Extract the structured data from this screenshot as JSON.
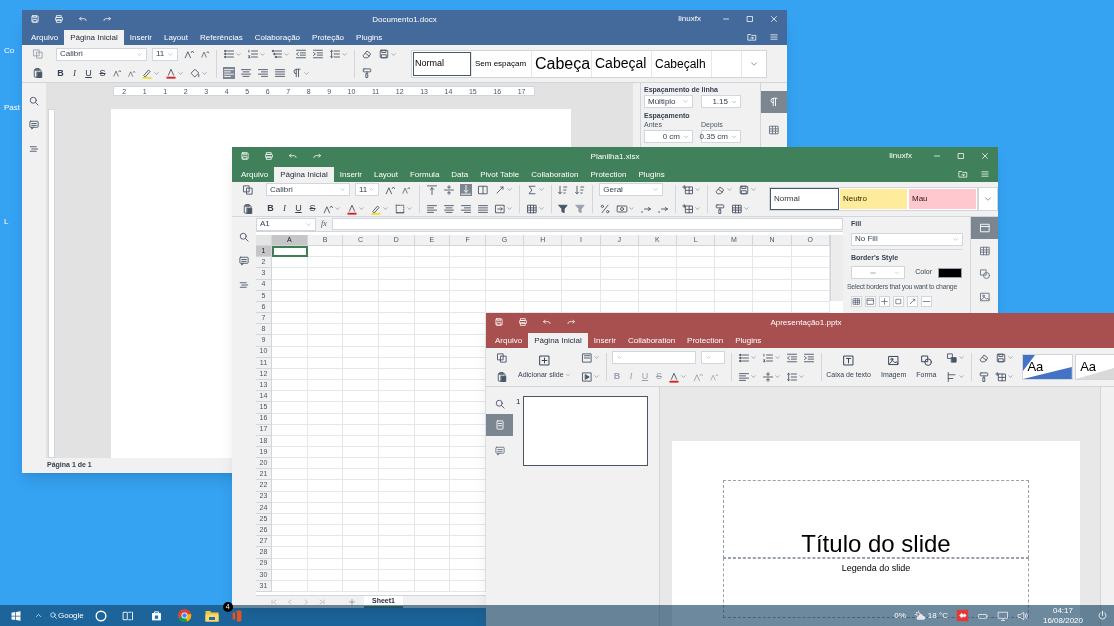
{
  "desktop_icons": [
    {
      "label": "Co"
    },
    {
      "label": "Past"
    },
    {
      "label": "L"
    }
  ],
  "document_window": {
    "title": "Documento1.docx",
    "user": "linuxfx",
    "tabs": [
      {
        "label": "Arquivo",
        "selected": false
      },
      {
        "label": "Página Inicial",
        "selected": true
      },
      {
        "label": "Inserir",
        "selected": false
      },
      {
        "label": "Layout",
        "selected": false
      },
      {
        "label": "Referências",
        "selected": false
      },
      {
        "label": "Colaboração",
        "selected": false
      },
      {
        "label": "Proteção",
        "selected": false
      },
      {
        "label": "Plugins",
        "selected": false
      }
    ],
    "font": "Calibri",
    "font_size": "11",
    "format_buttons": [
      {
        "label": "B",
        "kind": "bold",
        "disabled": false
      },
      {
        "label": "I",
        "kind": "italic",
        "disabled": false
      },
      {
        "label": "U",
        "kind": "underline",
        "disabled": false
      },
      {
        "label": "S",
        "kind": "strike",
        "disabled": false
      }
    ],
    "styles": [
      {
        "label": "Normal",
        "kind": "normal",
        "selected": true
      },
      {
        "label": "Sem espaçam",
        "kind": "small",
        "selected": false
      },
      {
        "label": "Cabeça",
        "kind": "heading1",
        "selected": false
      },
      {
        "label": "Cabeçal",
        "kind": "heading2",
        "selected": false
      },
      {
        "label": "Cabeçalh",
        "kind": "heading3",
        "selected": false
      }
    ],
    "ruler_labels": [
      "2",
      "1",
      "1",
      "2",
      "3",
      "4",
      "5",
      "6",
      "7",
      "8",
      "9",
      "10",
      "11",
      "12",
      "13",
      "14",
      "15",
      "16",
      "17"
    ],
    "paragraph_panel": {
      "line_spacing_label": "Espaçamento de linha",
      "line_spacing_mode": "Múltiplo",
      "line_spacing_value": "1.15",
      "spacing_label": "Espaçamento",
      "before_label": "Antes",
      "after_label": "Depois",
      "before_value": "0 cm",
      "after_value": "0.35 cm"
    },
    "side_tabs": [
      {
        "kind": "paragraph",
        "selected": true
      },
      {
        "kind": "table",
        "selected": false
      }
    ],
    "status": "Página 1 de 1"
  },
  "spreadsheet_window": {
    "title": "Planilha1.xlsx",
    "user": "linuxfx",
    "tabs": [
      {
        "label": "Arquivo",
        "selected": false
      },
      {
        "label": "Página Inicial",
        "selected": true
      },
      {
        "label": "Inserir",
        "selected": false
      },
      {
        "label": "Layout",
        "selected": false
      },
      {
        "label": "Formula",
        "selected": false
      },
      {
        "label": "Data",
        "selected": false
      },
      {
        "label": "Pivot Table",
        "selected": false
      },
      {
        "label": "Collaboration",
        "selected": false
      },
      {
        "label": "Protection",
        "selected": false
      },
      {
        "label": "Plugins",
        "selected": false
      }
    ],
    "font": "Calibri",
    "font_size": "11",
    "format_buttons": [
      {
        "label": "B",
        "kind": "bold",
        "disabled": false
      },
      {
        "label": "I",
        "kind": "italic",
        "disabled": false
      },
      {
        "label": "U",
        "kind": "underline",
        "disabled": false
      },
      {
        "label": "S",
        "kind": "strike",
        "disabled": false
      }
    ],
    "number_format": "Geral",
    "cell_styles": [
      {
        "label": "Normal",
        "color": "#ffffff",
        "selected": true
      },
      {
        "label": "Neutro",
        "color": "#ffeb9c",
        "selected": false
      },
      {
        "label": "Mau",
        "color": "#ffc7ce",
        "selected": false
      }
    ],
    "cell_reference": "A1",
    "formula_label": "fx",
    "columns": [
      {
        "label": "A",
        "selected": true
      },
      {
        "label": "B",
        "selected": false
      },
      {
        "label": "C",
        "selected": false
      },
      {
        "label": "D",
        "selected": false
      },
      {
        "label": "E",
        "selected": false
      },
      {
        "label": "F",
        "selected": false
      },
      {
        "label": "G",
        "selected": false
      },
      {
        "label": "H",
        "selected": false
      },
      {
        "label": "I",
        "selected": false
      },
      {
        "label": "J",
        "selected": false
      },
      {
        "label": "K",
        "selected": false
      },
      {
        "label": "L",
        "selected": false
      },
      {
        "label": "M",
        "selected": false
      },
      {
        "label": "N",
        "selected": false
      },
      {
        "label": "O",
        "selected": false
      }
    ],
    "rows": [
      {
        "label": "1",
        "selected": true
      },
      {
        "label": "2",
        "selected": false
      },
      {
        "label": "3",
        "selected": false
      },
      {
        "label": "4",
        "selected": false
      },
      {
        "label": "5",
        "selected": false
      },
      {
        "label": "6",
        "selected": false
      },
      {
        "label": "7",
        "selected": false
      },
      {
        "label": "8",
        "selected": false
      },
      {
        "label": "9",
        "selected": false
      },
      {
        "label": "10",
        "selected": false
      },
      {
        "label": "11",
        "selected": false
      },
      {
        "label": "12",
        "selected": false
      },
      {
        "label": "13",
        "selected": false
      },
      {
        "label": "14",
        "selected": false
      },
      {
        "label": "15",
        "selected": false
      },
      {
        "label": "16",
        "selected": false
      },
      {
        "label": "17",
        "selected": false
      },
      {
        "label": "18",
        "selected": false
      },
      {
        "label": "19",
        "selected": false
      },
      {
        "label": "20",
        "selected": false
      },
      {
        "label": "21",
        "selected": false
      },
      {
        "label": "22",
        "selected": false
      },
      {
        "label": "23",
        "selected": false
      },
      {
        "label": "24",
        "selected": false
      },
      {
        "label": "25",
        "selected": false
      },
      {
        "label": "26",
        "selected": false
      },
      {
        "label": "27",
        "selected": false
      },
      {
        "label": "28",
        "selected": false
      },
      {
        "label": "29",
        "selected": false
      },
      {
        "label": "30",
        "selected": false
      },
      {
        "label": "31",
        "selected": false
      }
    ],
    "format_panel": {
      "fill_label": "Fill",
      "fill_value": "No Fill",
      "border_style_label": "Border's Style",
      "color_label": "Color",
      "border_swatch": {
        "color": "#000000"
      },
      "borders_hint": "Select borders that you want to change"
    },
    "side_tabs": [
      {
        "kind": "cell",
        "selected": true
      },
      {
        "kind": "table",
        "selected": false
      },
      {
        "kind": "shapes",
        "selected": false
      },
      {
        "kind": "image",
        "selected": false
      }
    ],
    "sheet_tabs": [
      {
        "label": "Sheet1",
        "selected": true
      }
    ]
  },
  "presentation_window": {
    "title": "Apresentação1.pptx",
    "tabs": [
      {
        "label": "Arquivo",
        "selected": false
      },
      {
        "label": "Página Inicial",
        "selected": true
      },
      {
        "label": "Inserir",
        "selected": false
      },
      {
        "label": "Collaboration",
        "selected": false
      },
      {
        "label": "Protection",
        "selected": false
      },
      {
        "label": "Plugins",
        "selected": false
      }
    ],
    "add_slide": "Adicionar slide",
    "format_buttons": [
      {
        "label": "B",
        "kind": "bold",
        "disabled": true
      },
      {
        "label": "I",
        "kind": "italic",
        "disabled": true
      },
      {
        "label": "U",
        "kind": "underline",
        "disabled": true
      },
      {
        "label": "S",
        "kind": "strike",
        "disabled": true
      }
    ],
    "insert_buttons": [
      {
        "label": "Caixa de texto",
        "kind": "textbox"
      },
      {
        "label": "Imagem",
        "kind": "image"
      },
      {
        "label": "Forma",
        "kind": "shape"
      }
    ],
    "themes": [
      {
        "label": "Aa",
        "kind": "accent"
      },
      {
        "label": "Aa",
        "kind": "plain"
      }
    ],
    "side_tabs": [
      {
        "kind": "slides",
        "selected": true
      },
      {
        "kind": "comments",
        "selected": false
      }
    ],
    "slides": [
      {
        "number": "1",
        "selected": true
      }
    ],
    "slide": {
      "title": "Título do slide",
      "subtitle": "Legenda do slide"
    }
  },
  "taskbar": {
    "search_label": "Google",
    "badge": "4",
    "battery": "0%",
    "temperature": "18 °C",
    "time": "04:17",
    "date": "16/08/2020"
  }
}
